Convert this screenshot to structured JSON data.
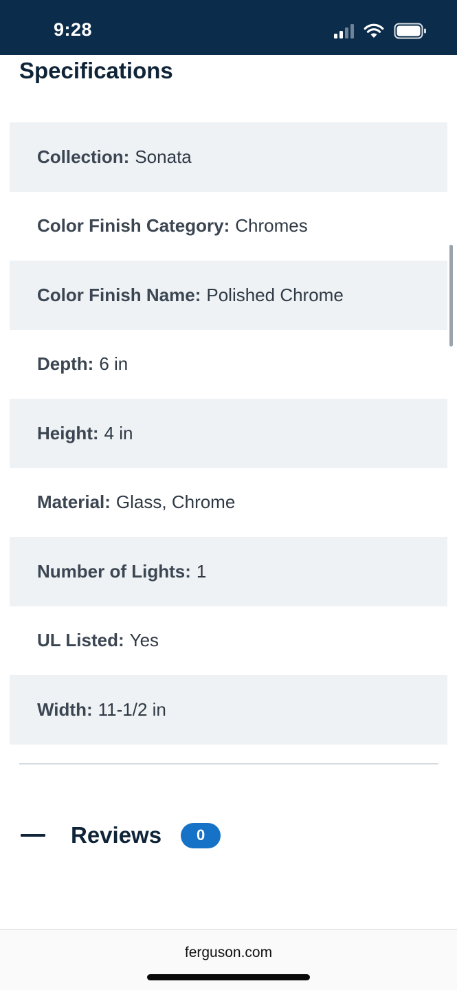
{
  "status_bar": {
    "time": "9:28"
  },
  "specifications": {
    "title": "Specifications",
    "rows": [
      {
        "label": "Collection:",
        "value": "Sonata"
      },
      {
        "label": "Color Finish Category:",
        "value": "Chromes"
      },
      {
        "label": "Color Finish Name:",
        "value": "Polished Chrome"
      },
      {
        "label": "Depth:",
        "value": "6 in"
      },
      {
        "label": "Height:",
        "value": "4 in"
      },
      {
        "label": "Material:",
        "value": "Glass, Chrome"
      },
      {
        "label": "Number of Lights:",
        "value": "1"
      },
      {
        "label": "UL Listed:",
        "value": "Yes"
      },
      {
        "label": "Width:",
        "value": "11-1/2 in"
      }
    ]
  },
  "reviews": {
    "label": "Reviews",
    "count": "0",
    "toggle_icon": "minus-icon"
  },
  "browser": {
    "domain": "ferguson.com"
  },
  "colors": {
    "status_bar_bg": "#0b2c4a",
    "shaded_row_bg": "#eef2f5",
    "badge_bg": "#1672c7"
  }
}
